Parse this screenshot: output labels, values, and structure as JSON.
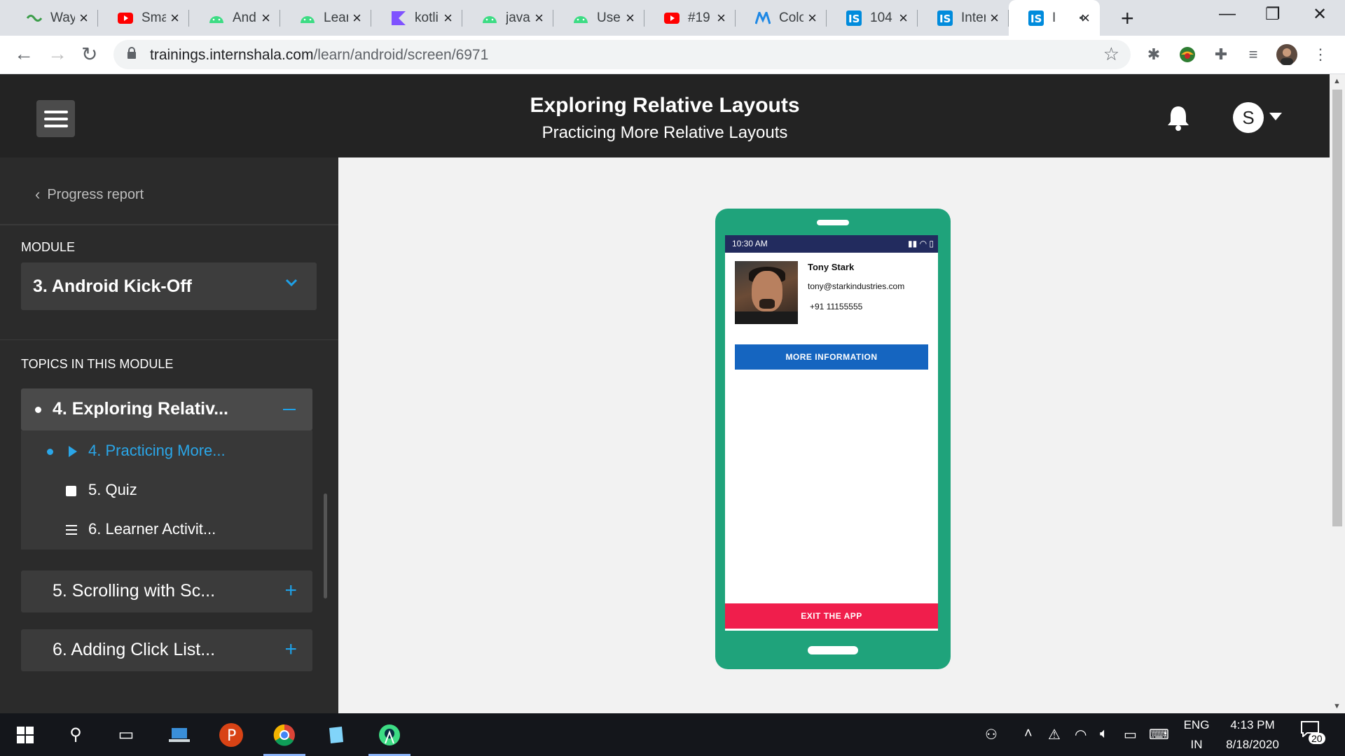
{
  "browser": {
    "tabs": [
      {
        "title": "Way",
        "icon": "waymo-icon",
        "color": "#3c9d4a"
      },
      {
        "title": "Sma",
        "icon": "youtube-icon",
        "color": "#ff0000"
      },
      {
        "title": "Andr",
        "icon": "android-icon",
        "color": "#3ddc84"
      },
      {
        "title": "Lear",
        "icon": "android-icon",
        "color": "#3ddc84"
      },
      {
        "title": "kotli",
        "icon": "kotlin-icon",
        "color": "#7f52ff"
      },
      {
        "title": "java",
        "icon": "android-icon",
        "color": "#3ddc84"
      },
      {
        "title": "Use",
        "icon": "android-icon",
        "color": "#3ddc84"
      },
      {
        "title": "#19",
        "icon": "youtube-icon",
        "color": "#ff0000"
      },
      {
        "title": "Colo",
        "icon": "material-icon",
        "color": "#1e88e5"
      },
      {
        "title": "104",
        "icon": "internshala-icon",
        "color": "#008bdc"
      },
      {
        "title": "Inter",
        "icon": "internshala-icon",
        "color": "#008bdc"
      },
      {
        "title": "I",
        "icon": "internshala-icon",
        "color": "#008bdc",
        "active": true
      }
    ],
    "url_host": "trainings.internshala.com",
    "url_path": "/learn/android/screen/6971"
  },
  "header": {
    "title": "Exploring Relative Layouts",
    "subtitle": "Practicing More Relative Layouts",
    "avatar_letter": "S"
  },
  "sidebar": {
    "progress_label": "Progress report",
    "module_label": "MODULE",
    "module_value": "3. Android Kick-Off",
    "topics_label": "TOPICS IN THIS MODULE",
    "active_topic": "4. Exploring Relativ...",
    "subtopics": [
      {
        "label": "4. Practicing More...",
        "type": "video",
        "current": true
      },
      {
        "label": "5. Quiz",
        "type": "quiz",
        "current": false
      },
      {
        "label": "6. Learner Activit...",
        "type": "text",
        "current": false
      }
    ],
    "other_topics": [
      "5. Scrolling with Sc...",
      "6. Adding Click List..."
    ]
  },
  "phone": {
    "time": "10:30 AM",
    "name": "Tony Stark",
    "email": "tony@starkindustries.com",
    "phone": "+91 11155555",
    "more_button": "MORE INFORMATION",
    "exit_button": "EXIT THE APP"
  },
  "taskbar": {
    "language": "ENG",
    "region": "IN",
    "time": "4:13 PM",
    "date": "8/18/2020",
    "notification_count": "20"
  },
  "colors": {
    "header_bg": "#232323",
    "sidebar_bg": "#2b2b2b",
    "accent_blue": "#2aa6e8",
    "phone_green": "#1fa37b",
    "status_bar": "#222b5e",
    "more_button": "#1565c0",
    "exit_button": "#f01e4c"
  }
}
